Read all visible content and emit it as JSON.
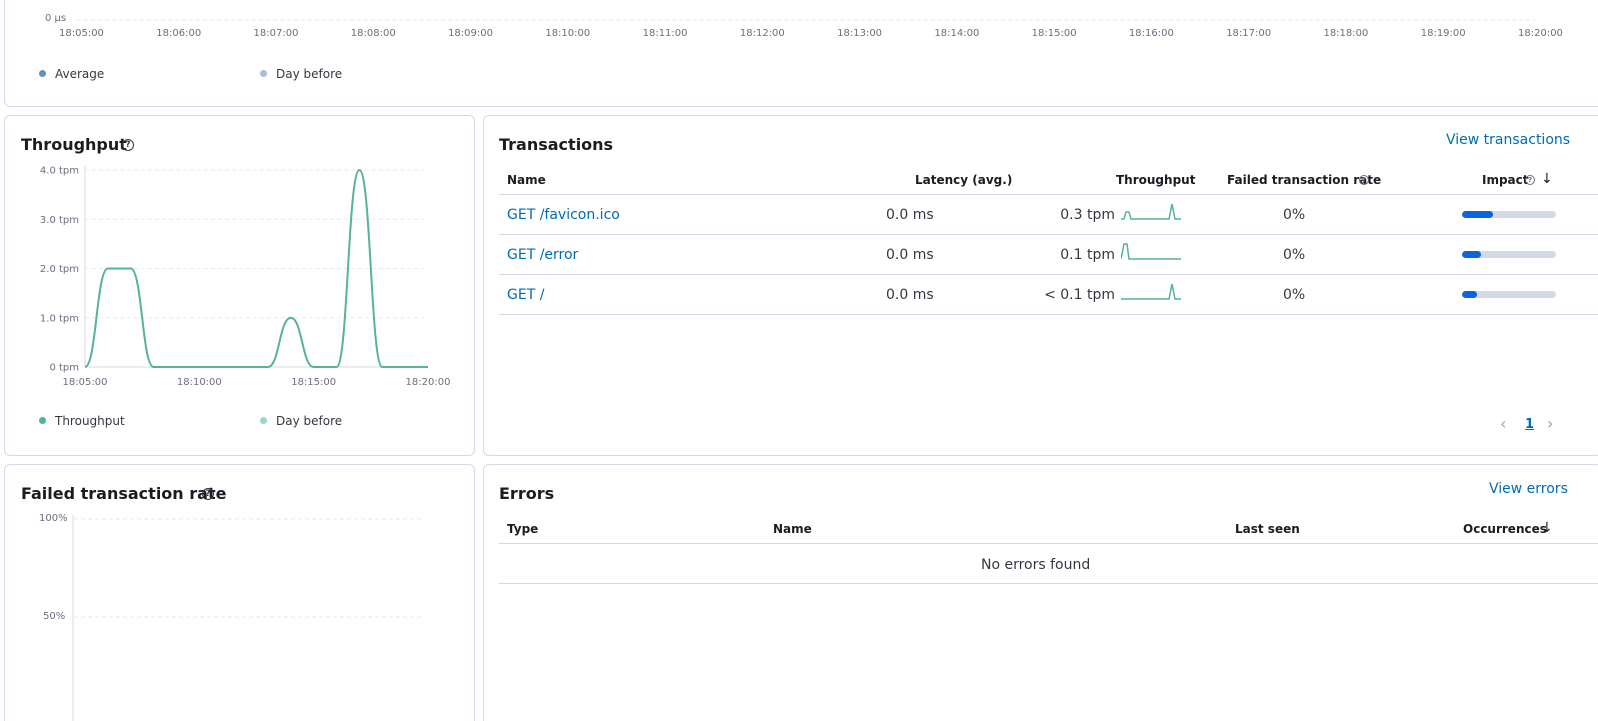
{
  "latency": {
    "y_tick": "0 µs",
    "x_ticks": [
      "18:05:00",
      "18:06:00",
      "18:07:00",
      "18:08:00",
      "18:09:00",
      "18:10:00",
      "18:11:00",
      "18:12:00",
      "18:13:00",
      "18:14:00",
      "18:15:00",
      "18:16:00",
      "18:17:00",
      "18:18:00",
      "18:19:00",
      "18:20:00"
    ],
    "legend": [
      {
        "label": "Average",
        "color": "#6092c0"
      },
      {
        "label": "Day before",
        "color": "#a8bfda"
      }
    ]
  },
  "throughput": {
    "title": "Throughput",
    "legend": [
      {
        "label": "Throughput",
        "color": "#54b399"
      },
      {
        "label": "Day before",
        "color": "#98d8c4"
      }
    ]
  },
  "transactions": {
    "title": "Transactions",
    "view_link": "View transactions",
    "columns": {
      "name": "Name",
      "latency": "Latency (avg.)",
      "throughput": "Throughput",
      "failed_rate": "Failed transaction rate",
      "impact": "Impact"
    },
    "rows": [
      {
        "name": "GET /favicon.ico",
        "latency": "0.0 ms",
        "throughput": "0.3 tpm",
        "failed_rate": "0%",
        "impact": 0.33
      },
      {
        "name": "GET /error",
        "latency": "0.0 ms",
        "throughput": "0.1 tpm",
        "failed_rate": "0%",
        "impact": 0.2
      },
      {
        "name": "GET /",
        "latency": "0.0 ms",
        "throughput": "< 0.1 tpm",
        "failed_rate": "0%",
        "impact": 0.16
      }
    ],
    "pagination": {
      "current": "1"
    }
  },
  "failed_rate": {
    "title": "Failed transaction rate",
    "y_ticks": [
      "100%",
      "50%"
    ]
  },
  "errors": {
    "title": "Errors",
    "view_link": "View errors",
    "columns": {
      "type": "Type",
      "name": "Name",
      "last_seen": "Last seen",
      "occurrences": "Occurrences"
    },
    "empty_message": "No errors found"
  },
  "chart_data": [
    {
      "type": "line",
      "title": "Throughput",
      "yticks": [
        "0 tpm",
        "1.0 tpm",
        "2.0 tpm",
        "3.0 tpm",
        "4.0 tpm"
      ],
      "xticks": [
        "18:05:00",
        "18:10:00",
        "18:15:00",
        "18:20:00"
      ],
      "ylim": [
        0,
        4
      ],
      "xlim": [
        "18:05:00",
        "18:20:00"
      ],
      "grid": true,
      "legend_position": "bottom-left",
      "series": [
        {
          "name": "Throughput",
          "color": "#54b399",
          "x": [
            "18:05:00",
            "18:06:00",
            "18:07:00",
            "18:08:00",
            "18:09:00",
            "18:10:00",
            "18:11:00",
            "18:12:00",
            "18:13:00",
            "18:14:00",
            "18:15:00",
            "18:16:00",
            "18:17:00",
            "18:18:00",
            "18:19:00",
            "18:20:00"
          ],
          "values": [
            0,
            2,
            2,
            0,
            0,
            0,
            0,
            0,
            0,
            1,
            0,
            0,
            4,
            0,
            0,
            0
          ]
        }
      ]
    },
    {
      "type": "line",
      "title": "Failed transaction rate",
      "yticks": [
        "50%",
        "100%"
      ],
      "ylim": [
        0,
        100
      ],
      "grid": true,
      "series": []
    }
  ]
}
